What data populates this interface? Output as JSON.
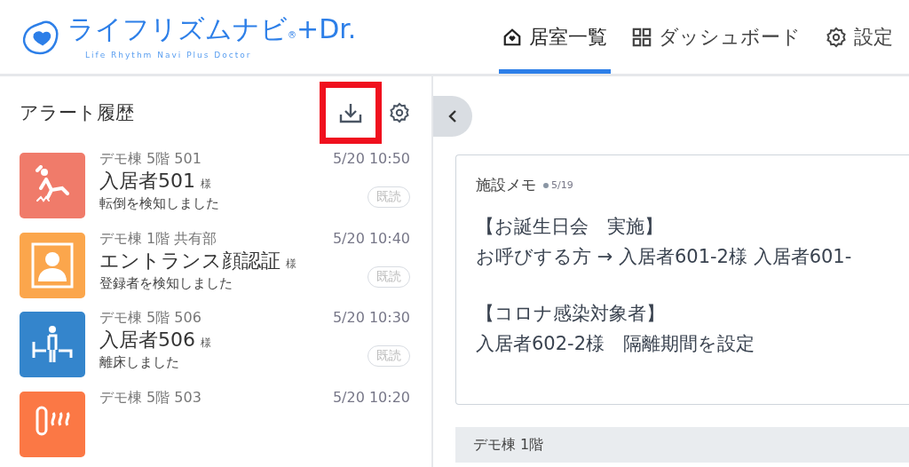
{
  "header": {
    "logo": {
      "title": "ライフリズムナビ$_{®}$+Dr.",
      "subtitle": "Life Rhythm Navi  Plus Doctor"
    },
    "tabs": [
      {
        "label": "居室一覧",
        "kind": "home",
        "selected": true
      },
      {
        "label": "ダッシュボード",
        "kind": "grid",
        "selected": false
      },
      {
        "label": "設定",
        "kind": "gear",
        "selected": false
      }
    ]
  },
  "alert_panel": {
    "title": "アラート履歴",
    "download_highlighted": true,
    "alerts": [
      {
        "kind": "fall",
        "color": "#f07b6a",
        "location": "デモ棟 5階 501",
        "name": "入居者501",
        "suffix": "様",
        "message": "転倒を検知しました",
        "time": "5/20 10:50",
        "badge": "既読"
      },
      {
        "kind": "face",
        "color": "#fba64c",
        "location": "デモ棟 1階 共有部",
        "name": "エントランス顔認証",
        "suffix": "様",
        "message": "登録者を検知しました",
        "time": "5/20 10:40",
        "badge": "既読"
      },
      {
        "kind": "bed",
        "color": "#3485cc",
        "location": "デモ棟 5階 506",
        "name": "入居者506",
        "suffix": "様",
        "message": "離床しました",
        "time": "5/20 10:30",
        "badge": "既読"
      },
      {
        "kind": "heat",
        "color": "#fb7845",
        "location": "デモ棟 5階 503",
        "time": "5/20 10:20"
      }
    ]
  },
  "memo": {
    "title": "施設メモ",
    "date": "5/19",
    "paragraphs": [
      [
        "【お誕生日会　実施】",
        "お呼びする方 → 入居者601-2様 入居者601-"
      ],
      [
        "【コロナ感染対象者】",
        "入居者602-2様　隔離期間を設定"
      ]
    ]
  },
  "section": {
    "title": "デモ棟 1階"
  }
}
